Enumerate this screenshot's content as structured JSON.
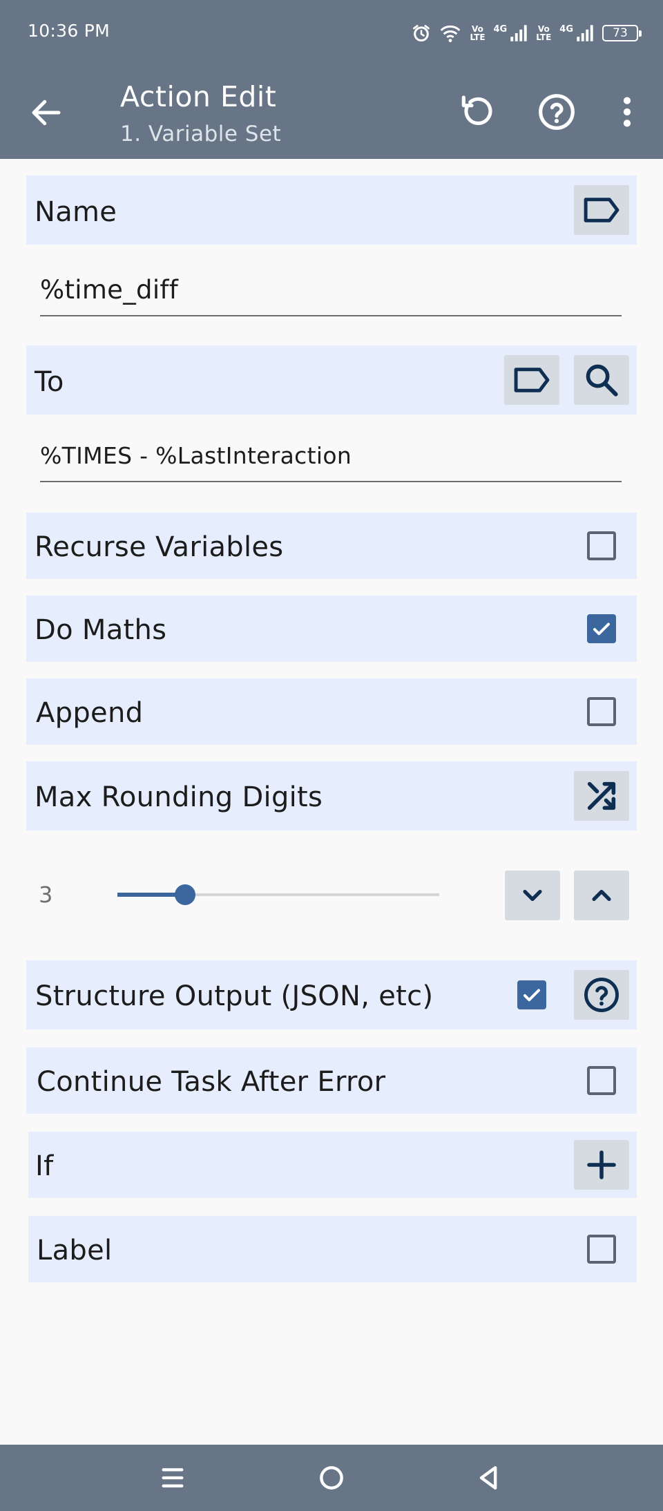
{
  "status_bar": {
    "time": "10:36 PM",
    "icons": [
      "alarm-icon",
      "wifi-icon",
      "volte-icon",
      "signal-icon",
      "volte-icon",
      "signal-icon"
    ],
    "volte_top": "Vo",
    "volte_bottom": "LTE",
    "network": "4G",
    "battery": "73"
  },
  "app_bar": {
    "title": "Action Edit",
    "subtitle": "1. Variable Set",
    "actions": [
      "undo-icon",
      "help-icon",
      "more-vert-icon"
    ]
  },
  "form": {
    "name": {
      "label": "Name",
      "value": "%time_diff",
      "action_icon": "label-tag-icon"
    },
    "to": {
      "label": "To",
      "value": "%TIMES - %LastInteraction",
      "action_icons": [
        "label-tag-icon",
        "search-icon"
      ]
    },
    "recurse_variables": {
      "label": "Recurse Variables",
      "checked": false
    },
    "do_maths": {
      "label": "Do Maths",
      "checked": true
    },
    "append": {
      "label": "Append",
      "checked": false
    },
    "max_rounding_digits": {
      "label": "Max Rounding Digits",
      "action_icon": "shuffle-icon",
      "value": "3",
      "slider_fraction": 0.21
    },
    "structure_output": {
      "label": "Structure Output (JSON, etc)",
      "checked": true,
      "action_icon": "help-icon"
    },
    "continue_task_after_error": {
      "label": "Continue Task After Error",
      "checked": false
    },
    "if": {
      "label": "If",
      "action_icon": "plus-icon"
    },
    "label": {
      "label": "Label",
      "checked": false
    }
  },
  "colors": {
    "bar": "#677587",
    "row_bg": "#e6edfd",
    "accent": "#3b679e",
    "button_bg": "#d6dbe2",
    "icon_dark": "#0f2f52"
  },
  "nav_bar": {
    "icons": [
      "recents-icon",
      "home-icon",
      "back-nav-icon"
    ]
  }
}
